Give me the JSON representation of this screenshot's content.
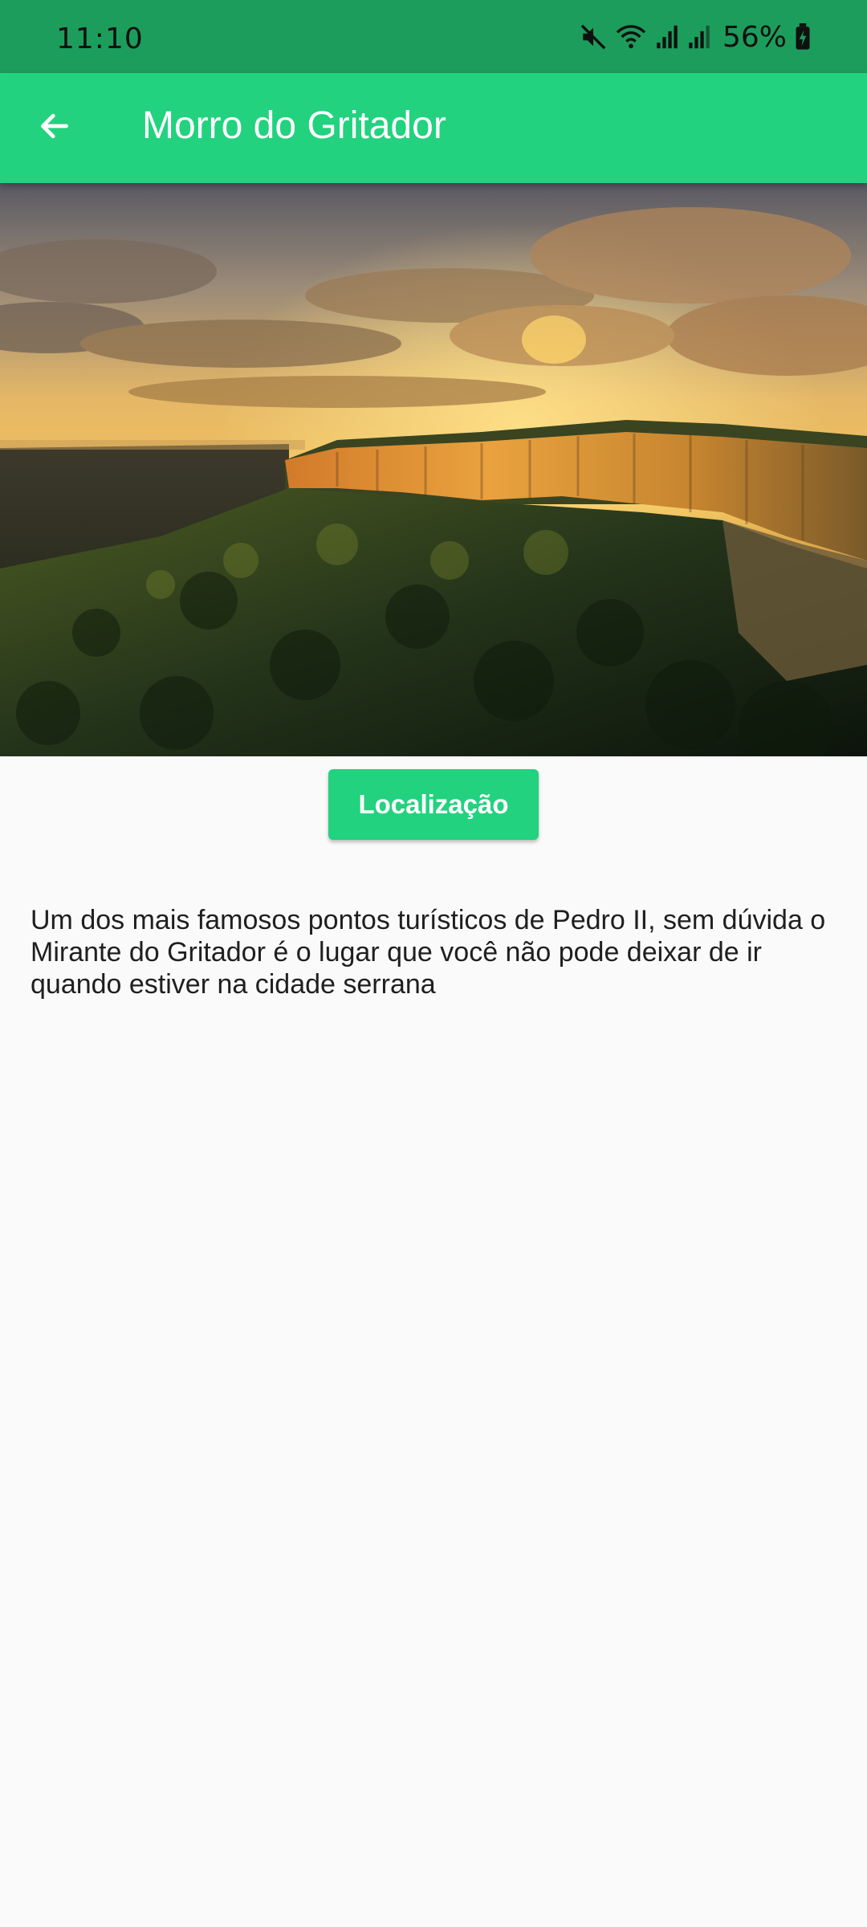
{
  "status_bar": {
    "time": "11:10",
    "battery_percent": "56%",
    "icons": [
      "mute-icon",
      "wifi-icon",
      "signal-icon",
      "signal-icon",
      "battery-charging-icon"
    ]
  },
  "app_bar": {
    "title": "Morro do Gritador",
    "back_icon": "arrow-back-icon"
  },
  "hero_image": {
    "subject": "cliff landscape at sunset"
  },
  "actions": {
    "location_label": "Localização"
  },
  "content": {
    "description": "Um dos mais famosos pontos turísticos de Pedro II, sem dúvida o Mirante do Gritador é o lugar que você não pode deixar de ir quando estiver na cidade serrana"
  },
  "colors": {
    "status_bar": "#1c9d5c",
    "app_bar": "#22d27e",
    "button": "#22d27e",
    "background": "#fafafa"
  }
}
